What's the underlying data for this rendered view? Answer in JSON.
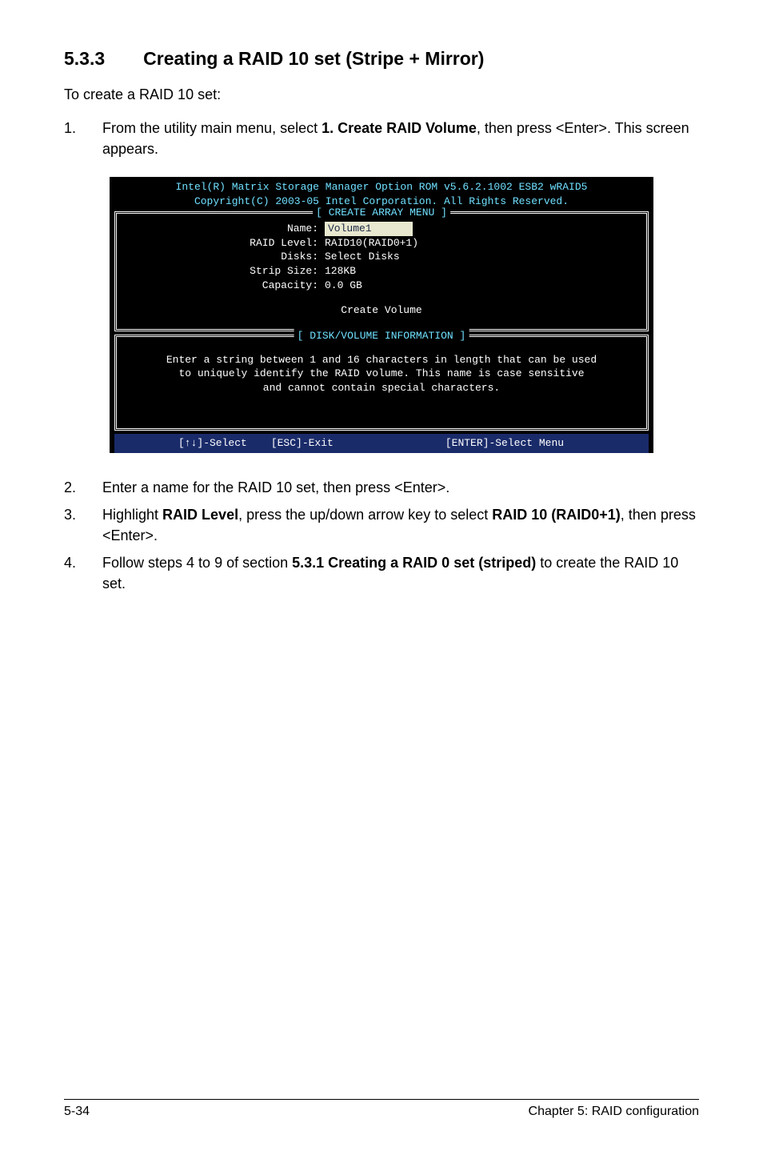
{
  "section": {
    "number": "5.3.3",
    "title": "Creating a RAID 10 set (Stripe + Mirror)"
  },
  "intro": "To create a RAID 10 set:",
  "step1": {
    "num": "1.",
    "pre": "From the utility main menu, select ",
    "bold": "1. Create RAID Volume",
    "post": ", then press <Enter>. This screen appears."
  },
  "bios": {
    "header1": "Intel(R) Matrix Storage Manager Option ROM v5.6.2.1002 ESB2 wRAID5",
    "header2": "Copyright(C) 2003-05 Intel Corporation. All Rights Reserved.",
    "panel1_title": "[ CREATE ARRAY MENU ]",
    "rows": {
      "name_label": "Name:",
      "name_value": "Volume1",
      "raid_label": "RAID Level:",
      "raid_value": "RAID10(RAID0+1)",
      "disks_label": "Disks:",
      "disks_value": "Select Disks",
      "strip_label": "Strip Size:",
      "strip_value": "128KB",
      "capacity_label": "Capacity:",
      "capacity_value": "0.0  GB"
    },
    "create_volume": "Create Volume",
    "panel2_title": "[ DISK/VOLUME INFORMATION ]",
    "info_text": "Enter a string between 1 and 16 characters in length that can be used\nto uniquely identify the RAID volume. This name is case sensitive\nand cannot contain special characters.",
    "footer": {
      "select": "[↑↓]-Select",
      "exit": "[ESC]-Exit",
      "enter": "[ENTER]-Select Menu"
    }
  },
  "step2": {
    "num": "2.",
    "text": "Enter a name for the RAID 10  set, then press <Enter>."
  },
  "step3": {
    "num": "3.",
    "pre": "Highlight ",
    "b1": "RAID Level",
    "mid": ", press the up/down arrow key to select ",
    "b2": "RAID 10 (RAID0+1)",
    "post": ", then press <Enter>."
  },
  "step4": {
    "num": "4.",
    "pre": "Follow steps 4 to 9 of section ",
    "b1": "5.3.1 Creating a RAID 0 set (striped)",
    "post": " to create the RAID 10 set."
  },
  "footer": {
    "left": "5-34",
    "right": "Chapter 5: RAID configuration"
  }
}
